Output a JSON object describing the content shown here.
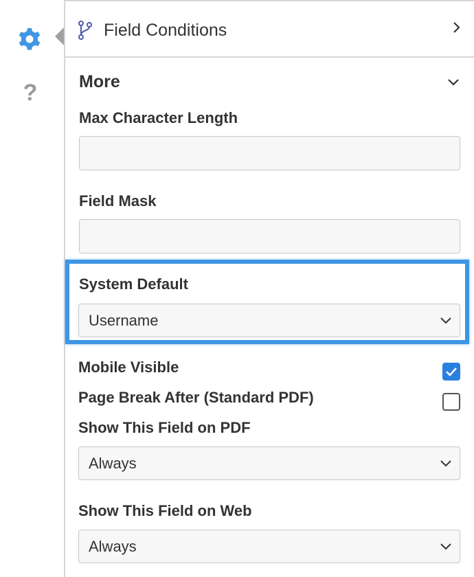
{
  "sidebar": {
    "gear_color": "#3f96e4",
    "help_label": "?"
  },
  "field_conditions": {
    "title": "Field Conditions"
  },
  "more": {
    "title": "More",
    "max_char_label": "Max Character Length",
    "max_char_value": "",
    "field_mask_label": "Field Mask",
    "field_mask_value": "",
    "system_default_label": "System Default",
    "system_default_value": "Username",
    "mobile_visible_label": "Mobile Visible",
    "mobile_visible_checked": true,
    "page_break_label": "Page Break After (Standard PDF)",
    "page_break_checked": false,
    "show_pdf_label": "Show This Field on PDF",
    "show_pdf_value": "Always",
    "show_web_label": "Show This Field on Web",
    "show_web_value": "Always"
  },
  "colors": {
    "accent": "#3f96e4",
    "checkbox": "#2b7fe0"
  }
}
